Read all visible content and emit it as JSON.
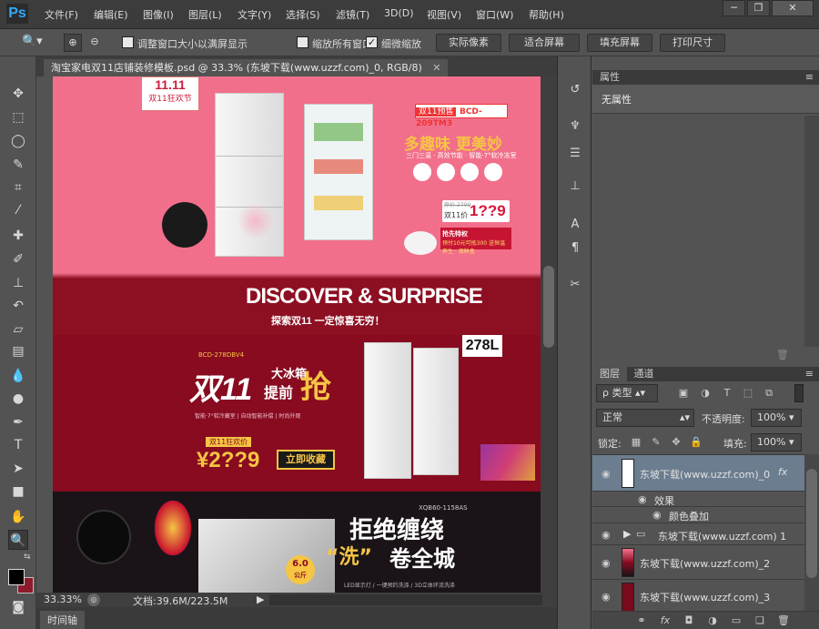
{
  "app": {
    "logo": "Ps",
    "menus": [
      "文件(F)",
      "编辑(E)",
      "图像(I)",
      "图层(L)",
      "文字(Y)",
      "选择(S)",
      "滤镜(T)",
      "3D(D)",
      "视图(V)",
      "窗口(W)",
      "帮助(H)"
    ],
    "window_buttons": {
      "minimize": "─",
      "restore": "❐",
      "close": "✕"
    }
  },
  "options": {
    "resize_windows_label": "调整窗口大小以满屏显示",
    "zoom_all_label": "缩放所有窗口",
    "scrubby_zoom_label": "细微缩放",
    "actual_pixels": "实际像素",
    "fit_screen": "适合屏幕",
    "fill_screen": "填充屏幕",
    "print_size": "打印尺寸",
    "resize_checked": false,
    "zoom_all_checked": false,
    "scrubby_checked": true
  },
  "document": {
    "tab_title": "淘宝家电双11店铺装修模板.psd @ 33.3% (东坡下载(www.uzzf.com)_0, RGB/8)",
    "close_glyph": "✕"
  },
  "canvas_art": {
    "badge_top": "11.11",
    "badge_sub": "双11狂欢节",
    "presale_tag": "双11预售",
    "model1": "BCD-209TM3",
    "slogan1": "多趣味 更美妙",
    "feature_line": "三门三温 · 高效节能 · 智能·7°软冷冻室",
    "old_price": "原价 2799",
    "price_label1": "双11价",
    "price1": "1??9",
    "gift_label": "抢先特权",
    "gift_text": "预付10元可抵300 送恒温养生 · 保鲜盒",
    "discover": "DISCOVER & SURPRISE",
    "discover_sub": "探索双11 一定惊喜无穷！",
    "size_badge": "278L",
    "model2": "BCD-278DBV4",
    "headline_a": "双11",
    "headline_b": "大冰箱",
    "headline_c": "提前",
    "headline_d": "抢",
    "feature_line2": "智能·7°软冷藏室 | 自动智能补偿 | 时尚外观",
    "price_label2": "双11狂欢价",
    "price2": "¥2??9",
    "collect_btn": "立即收藏",
    "model3": "XQB60-1158AS",
    "headline_e": "拒绝缠绕",
    "headline_f": "“洗”",
    "headline_g": "卷全城",
    "capacity_top": "6.0",
    "capacity_unit": "公斤",
    "feature_line3": "LED显示灯 / 一键预约洗涤 / 3D立体环流洗涤"
  },
  "status": {
    "zoom": "33.33%",
    "doc_size": "文档:39.6M/223.5M",
    "timeline_tab": "时间轴"
  },
  "properties": {
    "tab": "属性",
    "content": "无属性"
  },
  "layers": {
    "tab_layers": "图层",
    "tab_channels": "通道",
    "filter_label": "ρ 类型",
    "blend_mode": "正常",
    "opacity_label": "不透明度:",
    "opacity_value": "100%",
    "lock_label": "锁定:",
    "fill_label": "填充:",
    "fill_value": "100%",
    "fx_glyph": "fx",
    "items": [
      {
        "name": "东坡下载(www.uzzf.com)_0",
        "selected": true,
        "has_fx": true
      },
      {
        "name": "效果",
        "sub": true
      },
      {
        "name": "颜色叠加",
        "sub": true
      },
      {
        "name": "东坡下载(www.uzzf.com) 1",
        "group": true
      },
      {
        "name": "东坡下载(www.uzzf.com)_2"
      },
      {
        "name": "东坡下载(www.uzzf.com)_3"
      }
    ]
  },
  "colors": {
    "ui_bg": "#535353",
    "panel_dark": "#3a3a3a",
    "accent": "#31a8ff",
    "banner_pink": "#f26f8b",
    "banner_red": "#880b20",
    "gold": "#f6c544"
  }
}
